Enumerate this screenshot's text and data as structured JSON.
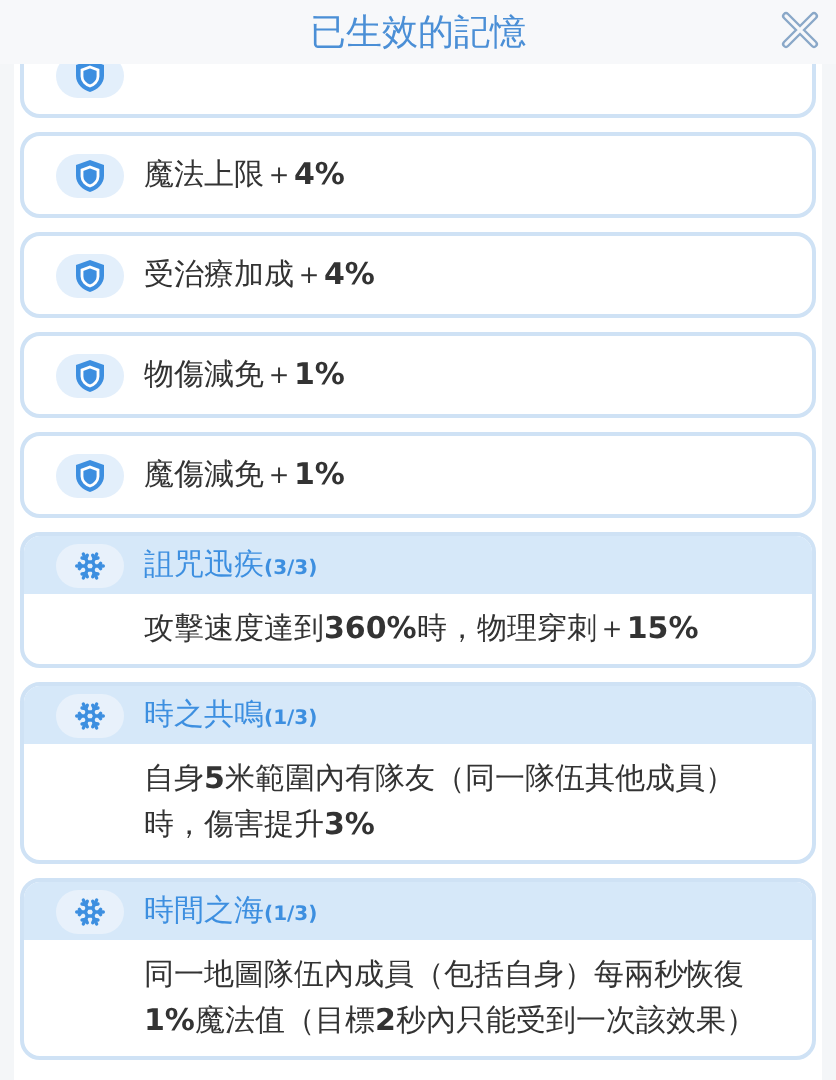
{
  "window": {
    "title": "已生效的記憶"
  },
  "items": [
    {
      "kind": "stat"
    },
    {
      "kind": "stat",
      "text": "魔法上限＋**4%**"
    },
    {
      "kind": "stat",
      "text": "受治療加成＋**4%**"
    },
    {
      "kind": "stat",
      "text": "物傷減免＋**1%**"
    },
    {
      "kind": "stat",
      "text": "魔傷減免＋**1%**"
    },
    {
      "kind": "set",
      "name": "詛咒迅疾",
      "count": "(3/3)",
      "text": "攻擊速度達到**360%**時，物理穿刺＋**15%**"
    },
    {
      "kind": "set",
      "name": "時之共鳴",
      "count": "(1/3)",
      "text": "自身**5**米範圍內有隊友（同一隊伍其他成員）時，傷害提升**3%**"
    },
    {
      "kind": "set",
      "name": "時間之海",
      "count": "(1/3)",
      "text": "同一地圖隊伍內成員（包括自身）每兩秒恢復**1%**魔法值（目標**2**秒內只能受到一次該效果）"
    }
  ]
}
